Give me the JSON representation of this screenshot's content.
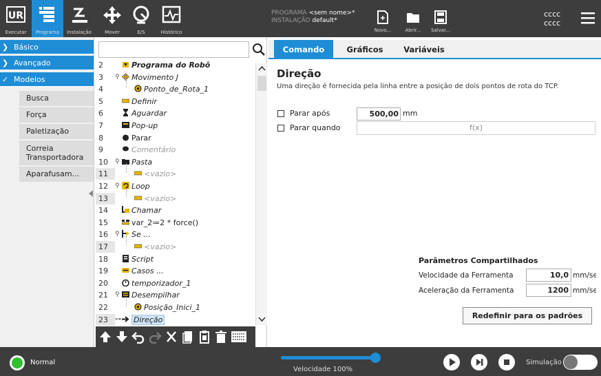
{
  "colors": {
    "accent": "#1f8dd6",
    "bar": "#3d3d3d",
    "status_ok": "#2fbf2f",
    "warn": "#e8b400"
  },
  "topnav": [
    {
      "label": "Executar",
      "icon": "ur-logo-icon"
    },
    {
      "label": "Programa",
      "icon": "program-icon",
      "active": true
    },
    {
      "label": "Instalação",
      "icon": "installation-icon"
    },
    {
      "label": "Mover",
      "icon": "move-icon"
    },
    {
      "label": "E/S",
      "icon": "io-icon"
    },
    {
      "label": "Histórico",
      "icon": "log-icon"
    }
  ],
  "program": {
    "program_label": "PROGRAMA",
    "program_value": "<sem nome>*",
    "install_label": "INSTALAÇÃO",
    "install_value": "default*"
  },
  "file_actions": [
    {
      "label": "Novo...",
      "icon": "new-file-icon"
    },
    {
      "label": "Abrir...",
      "icon": "open-folder-icon"
    },
    {
      "label": "Salvar...",
      "icon": "save-icon"
    }
  ],
  "top_right": {
    "line1": "cccc",
    "line2": "cccc",
    "menu_icon": "hamburger-menu-icon"
  },
  "sidebar": {
    "categories": [
      {
        "label": "Básico",
        "chevron": "❯"
      },
      {
        "label": "Avançado",
        "chevron": "❯"
      },
      {
        "label": "Modelos",
        "chevron": "✓"
      }
    ],
    "items": [
      "Busca",
      "Força",
      "Paletização",
      "Correia",
      "Transportadora",
      "Aparafusam..."
    ]
  },
  "tree": {
    "rows": [
      {
        "line": "2",
        "text": "Programa do Robô",
        "style": "bolditalic"
      },
      {
        "line": "3",
        "text": "Movimento J",
        "style": "it"
      },
      {
        "line": "4",
        "text": "Ponto_de_Rota_1",
        "style": "it"
      },
      {
        "line": "5",
        "text": "Definir",
        "style": "it"
      },
      {
        "line": "6",
        "text": "Aguardar",
        "style": "it"
      },
      {
        "line": "7",
        "text": "Pop-up",
        "style": "it"
      },
      {
        "line": "8",
        "text": "Parar",
        "style": ""
      },
      {
        "line": "9",
        "text": "Comentário",
        "style": "dim"
      },
      {
        "line": "10",
        "text": "Pasta",
        "style": "it"
      },
      {
        "line": "11",
        "text": "<vazio>",
        "style": "dim"
      },
      {
        "line": "12",
        "text": "Loop",
        "style": "it"
      },
      {
        "line": "13",
        "text": "<vazio>",
        "style": "dim"
      },
      {
        "line": "14",
        "text": "Chamar",
        "style": "it"
      },
      {
        "line": "15",
        "text": "var_2≔2 * force()",
        "style": ""
      },
      {
        "line": "16",
        "text": "Se ...",
        "style": "it"
      },
      {
        "line": "17",
        "text": "<vazio>",
        "style": "dim"
      },
      {
        "line": "18",
        "text": "Script",
        "style": "it"
      },
      {
        "line": "19",
        "text": "Casos ...",
        "style": "it"
      },
      {
        "line": "20",
        "text": "temporizador_1",
        "style": "it"
      },
      {
        "line": "21",
        "text": "Desempilhar",
        "style": "it"
      },
      {
        "line": "22",
        "text": "Posição_Inici_1",
        "style": "it"
      },
      {
        "line": "23",
        "text": "Direção",
        "style": "it"
      }
    ]
  },
  "tabs": [
    "Comando",
    "Gráficos",
    "Variáveis"
  ],
  "direction": {
    "title": "Direção",
    "description": "Uma direção é fornecida pela linha entre a posição de dois pontos de rota do TCP.",
    "stop_after_label": "Parar após",
    "stop_after_value": "500,00",
    "stop_after_unit": "mm",
    "stop_when_label": "Parar quando",
    "stop_when_value": "f(x)"
  },
  "shared": {
    "title": "Parâmetros Compartilhados",
    "tool_speed_label": "Velocidade da Ferramenta",
    "tool_speed_value": "10,0",
    "tool_speed_unit": "mm/se",
    "tool_accel_label": "Aceleração da Ferramenta",
    "tool_accel_value": "1200",
    "tool_accel_unit": "mm/se",
    "reset_label": "Redefinir para os padrões"
  },
  "bottom": {
    "status": "Normal",
    "speed_label": "Velocidade 100%",
    "speed_fraction": 1.0,
    "sim_label": "Simulação"
  }
}
